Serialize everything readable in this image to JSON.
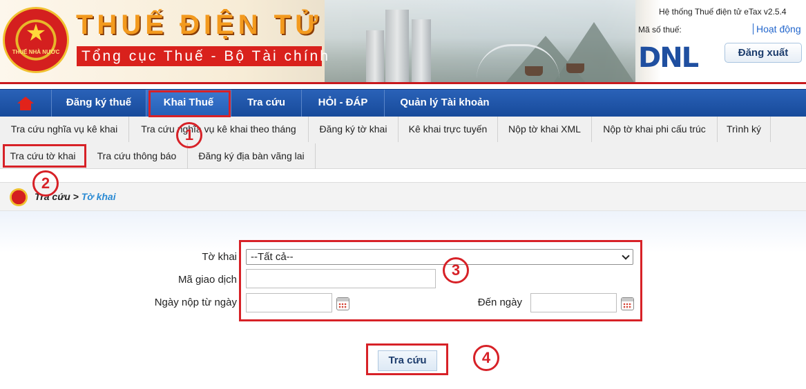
{
  "header": {
    "emblem_text": "THUẾ NHÀ NƯỚC",
    "title": "THUẾ ĐIỆN TỬ",
    "subtitle": "Tổng cục Thuế - Bộ Tài chính",
    "system_version": "Hệ thống Thuế điện tử eTax v2.5.4",
    "tax_code_label": "Mã số thuế:",
    "status_link": "Hoạt động",
    "logout_label": "Đăng xuất",
    "company_logo": "DNL"
  },
  "main_nav": {
    "items": [
      {
        "label": "Đăng ký thuế"
      },
      {
        "label": "Khai Thuế",
        "active": true
      },
      {
        "label": "Tra cứu"
      },
      {
        "label": "HỎI - ĐÁP"
      },
      {
        "label": "Quản lý Tài khoản"
      }
    ]
  },
  "sub_nav": {
    "row1": [
      "Tra cứu nghĩa vụ kê khai",
      "Tra cứu nghĩa vụ kê khai theo tháng",
      "Đăng ký tờ khai",
      "Kê khai trực tuyến",
      "Nộp tờ khai XML",
      "Nộp tờ khai phi cấu trúc",
      "Trình ký"
    ],
    "row2": [
      "Tra cứu tờ khai",
      "Tra cứu thông báo",
      "Đăng ký địa bàn vãng lai"
    ]
  },
  "breadcrumb": {
    "parent": "Tra cứu",
    "separator": ">",
    "current": "Tờ khai"
  },
  "form": {
    "declaration_label": "Tờ khai",
    "declaration_value": "--Tất cả--",
    "transaction_code_label": "Mã giao dịch",
    "transaction_code_value": "",
    "from_date_label": "Ngày nộp từ ngày",
    "from_date_value": "",
    "to_date_label": "Đến ngày",
    "to_date_value": "",
    "search_button": "Tra cứu"
  },
  "annotations": {
    "step1": "1",
    "step2": "2",
    "step3": "3",
    "step4": "4",
    "color": "#d72127"
  },
  "colors": {
    "nav_blue": "#1f57ad",
    "banner_red": "#c8191d",
    "title_orange": "#f39a1e",
    "link_blue": "#2a8ad3"
  }
}
